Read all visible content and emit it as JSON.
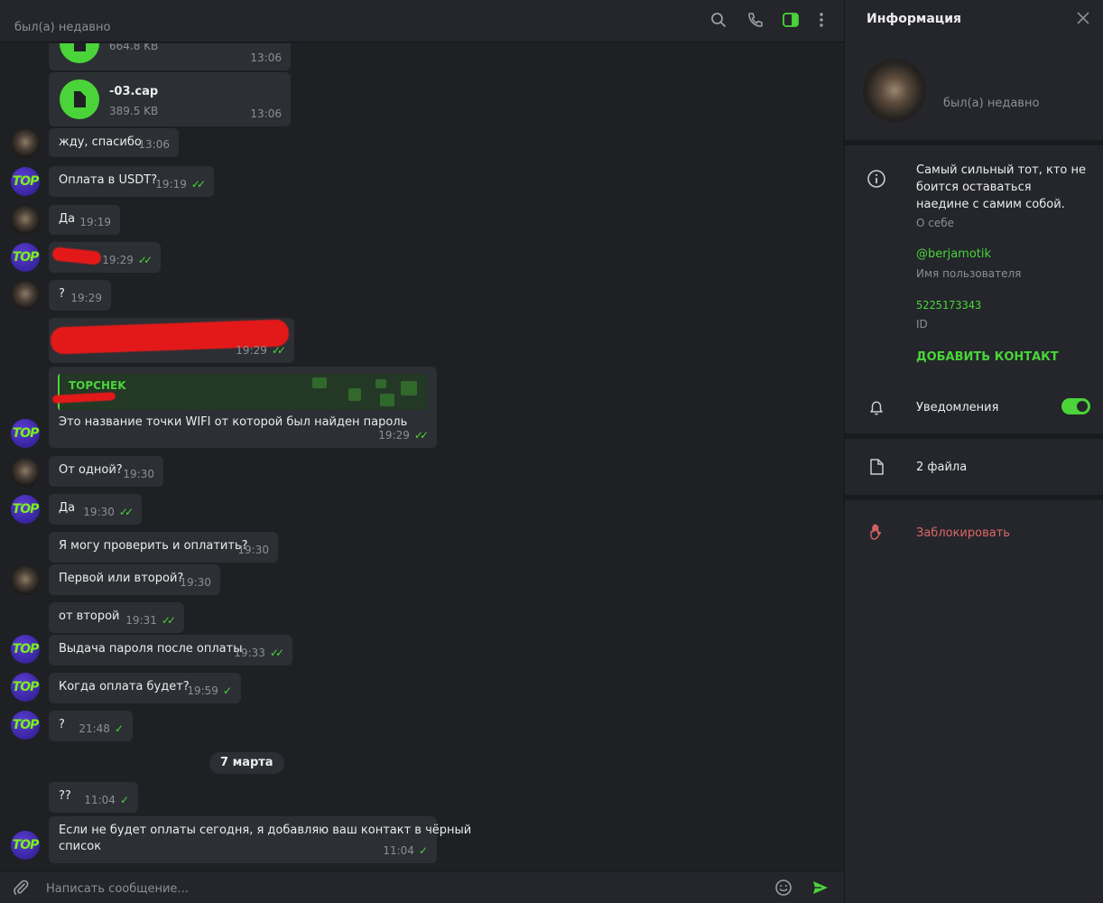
{
  "chat": {
    "status": "был(а) недавно",
    "composer_placeholder": "Написать сообщение...",
    "date_divider": "7 марта",
    "files": [
      {
        "name": "",
        "size": "664.8 KB",
        "time": "13:06"
      },
      {
        "name": "-03.cap",
        "size": "389.5 KB",
        "time": "13:06"
      }
    ],
    "messages": [
      {
        "text": "жду, спасибо",
        "time": "13:06"
      },
      {
        "text": "Оплата в USDT?",
        "time": "19:19"
      },
      {
        "text": "Да",
        "time": "19:19"
      },
      {
        "text": "",
        "time": "19:29"
      },
      {
        "text": "?",
        "time": "19:29"
      },
      {
        "text": "",
        "time": "19:29"
      },
      {
        "reply_name": "TOPCHEK",
        "text": "Это название точки WIFI от которой был найден пароль",
        "time": "19:29"
      },
      {
        "text": "От одной?",
        "time": "19:30"
      },
      {
        "text": "Да",
        "time": "19:30"
      },
      {
        "text": "Я могу проверить и оплатить?",
        "time": "19:30"
      },
      {
        "text": "Первой или второй?",
        "time": "19:30"
      },
      {
        "text": "от второй",
        "time": "19:31"
      },
      {
        "text": "Выдача пароля после оплаты",
        "time": "19:33"
      },
      {
        "text": "Когда оплата будет?",
        "time": "19:59"
      },
      {
        "text": "?",
        "time": "21:48"
      },
      {
        "text": "??",
        "time": "11:04"
      },
      {
        "text_line1": "Если не будет оплаты сегодня, я добавляю ваш контакт в чёрный",
        "text_line2": "список",
        "time": "11:04"
      }
    ],
    "avatar_label": "TOP"
  },
  "info": {
    "title": "Информация",
    "last_seen": "был(а) недавно",
    "bio": "Самый сильный тот, кто не боится оставаться наедине с самим собой.",
    "bio_label": "О себе",
    "username": "@berjamotik",
    "username_label": "Имя пользователя",
    "id": "5225173343",
    "id_label": "ID",
    "add_contact": "ДОБАВИТЬ КОНТАКТ",
    "notifications": "Уведомления",
    "notifications_on": true,
    "files": "2 файла",
    "block": "Заблокировать"
  },
  "colors": {
    "accent": "#4ad43a",
    "danger": "#e06666",
    "bubble": "#2c2f34",
    "background": "#1e2024"
  }
}
